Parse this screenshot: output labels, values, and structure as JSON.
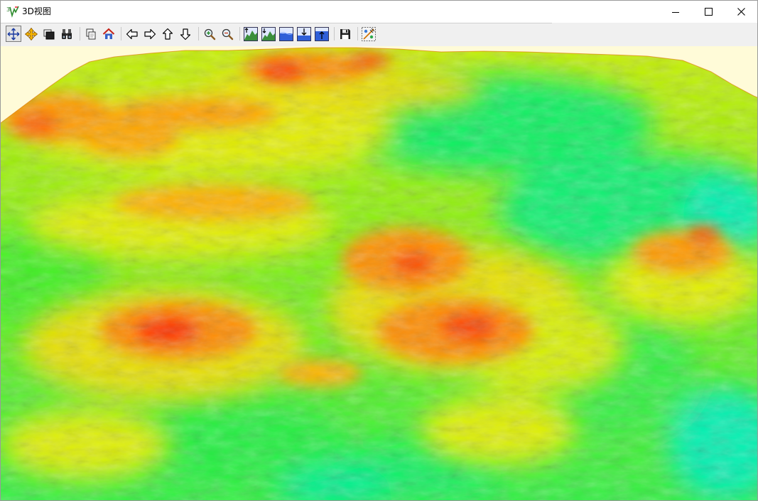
{
  "window": {
    "title": "3D视图",
    "app_icon": "3d-terrain-app-icon",
    "controls": [
      "minimize-icon",
      "maximize-icon",
      "close-icon"
    ]
  },
  "toolbar": {
    "buttons": [
      {
        "icon": "pan-move-icon",
        "pressed": true
      },
      {
        "icon": "orbit-move-icon",
        "pressed": false
      },
      {
        "icon": "layer-display-icon",
        "pressed": false
      },
      {
        "icon": "binoculars-icon",
        "pressed": false
      },
      {
        "icon": "copy-view-icon",
        "pressed": false
      },
      {
        "icon": "home-view-icon",
        "pressed": false
      },
      {
        "icon": "arrow-left-icon",
        "pressed": false
      },
      {
        "icon": "arrow-right-icon",
        "pressed": false
      },
      {
        "icon": "arrow-up-icon",
        "pressed": false
      },
      {
        "icon": "arrow-down-icon",
        "pressed": false
      },
      {
        "icon": "zoom-in-icon",
        "pressed": false
      },
      {
        "icon": "zoom-out-icon",
        "pressed": false
      },
      {
        "icon": "terrain-exaggerate-up-icon",
        "pressed": false
      },
      {
        "icon": "terrain-exaggerate-down-icon",
        "pressed": false
      },
      {
        "icon": "water-level-icon",
        "pressed": false
      },
      {
        "icon": "water-level-down-icon",
        "pressed": false
      },
      {
        "icon": "water-level-up-icon",
        "pressed": false
      },
      {
        "icon": "save-icon",
        "pressed": false
      },
      {
        "icon": "render-settings-icon",
        "pressed": false
      }
    ]
  },
  "scene": {
    "content": "3d-terrain-elevation-surface",
    "background_color": "#fffbd8",
    "elevation_colors": [
      "#00f0b0",
      "#10f060",
      "#60f010",
      "#e8f000",
      "#ffc000",
      "#ff7800",
      "#ff3000"
    ]
  }
}
